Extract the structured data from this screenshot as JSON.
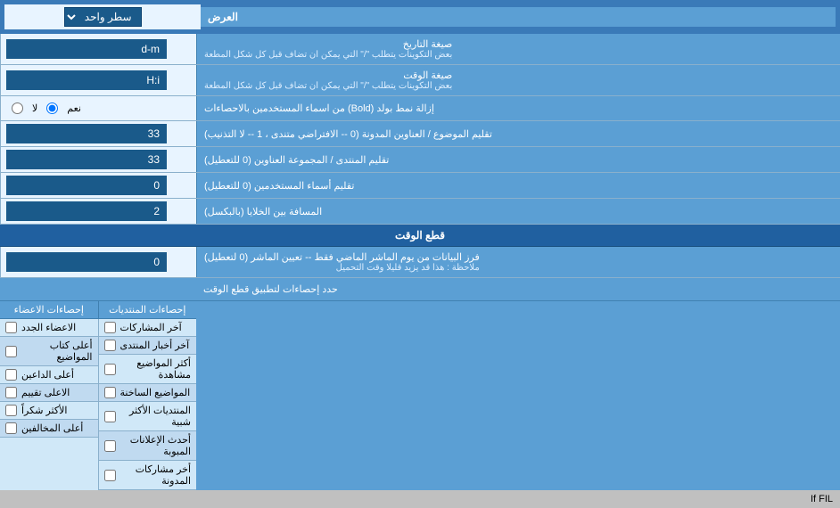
{
  "header": {
    "label": "العرض",
    "dropdown_label": "سطر واحد",
    "dropdown_icon": "▼"
  },
  "rows": [
    {
      "id": "date-format",
      "label": "صيغة التاريخ",
      "sublabel": "بعض التكوينات يتطلب \"/\" التي يمكن ان تضاف قبل كل شكل المطعة",
      "value": "d-m",
      "type": "input"
    },
    {
      "id": "time-format",
      "label": "صيغة الوقت",
      "sublabel": "بعض التكوينات يتطلب \"/\" التي يمكن ان تضاف قبل كل شكل المطعة",
      "value": "H:i",
      "type": "input"
    },
    {
      "id": "bold-remove",
      "label": "إزالة نمط بولد (Bold) من اسماء المستخدمين بالاحصاءات",
      "value": "radio",
      "type": "radio",
      "options": [
        "نعم",
        "لا"
      ],
      "selected": "نعم"
    },
    {
      "id": "topic-subject",
      "label": "تقليم الموضوع / العناوين المدونة (0 -- الافتراضي متندى ، 1 -- لا التذنيب)",
      "value": "33",
      "type": "input"
    },
    {
      "id": "forum-group",
      "label": "تقليم المنتدى / المجموعة العناوين (0 للتعطيل)",
      "value": "33",
      "type": "input"
    },
    {
      "id": "usernames",
      "label": "تقليم أسماء المستخدمين (0 للتعطيل)",
      "value": "0",
      "type": "input"
    },
    {
      "id": "cell-spacing",
      "label": "المسافة بين الخلايا (بالبكسل)",
      "value": "2",
      "type": "input"
    }
  ],
  "cutoff_section": {
    "title": "قطع الوقت",
    "row": {
      "label": "فرز البيانات من يوم الماشر الماضي فقط -- تعيين الماشر (0 لتعطيل)",
      "sublabel": "ملاحظة : هذا قد يزيد قليلا وقت التحميل",
      "value": "0"
    },
    "stats_label": "حدد إحصاءات لتطبيق قطع الوقت"
  },
  "stats": {
    "col1_header": "إحصاءات المنتديات",
    "col2_header": "إحصاءات الاعضاء",
    "col1_items": [
      "آخر المشاركات",
      "آخر أخبار المنتدى",
      "أكثر المواضيع مشاهدة",
      "المواضيع الساخنة",
      "المنتديات الأكثر شبية",
      "أحدث الإعلانات المبوبة",
      "أخر مشاركات المدونة"
    ],
    "col2_items": [
      "الاعضاء الجدد",
      "أعلى كتاب المواضيع",
      "أعلى الداعين",
      "الاعلى تقييم",
      "الأكثر شكراً",
      "أعلى المخالفين"
    ]
  }
}
